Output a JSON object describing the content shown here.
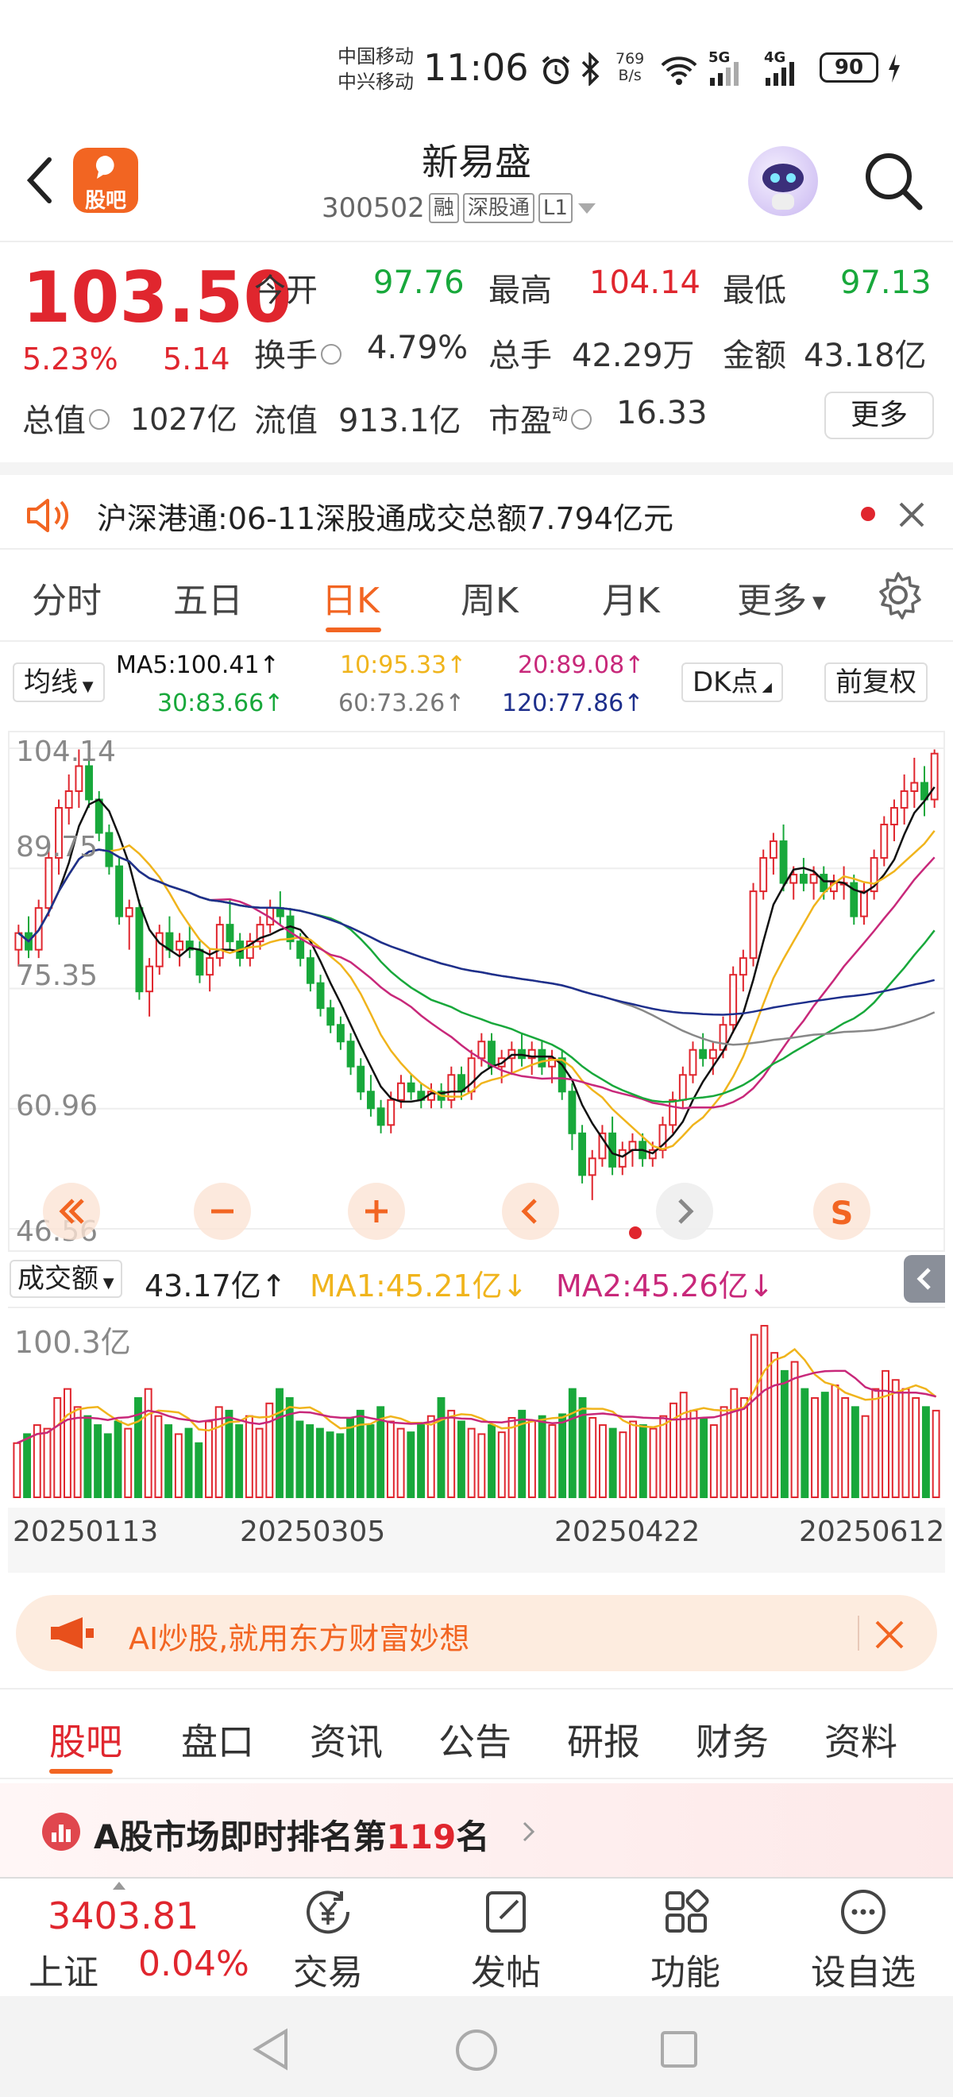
{
  "status_bar": {
    "carrier1": "中国移动",
    "carrier2": "中兴移动",
    "time": "11:06",
    "net_speed_value": "769",
    "net_speed_unit": "B/s",
    "signal1": "5G",
    "signal2": "4G",
    "battery": "90"
  },
  "header": {
    "logo_label": "股吧",
    "stock_name": "新易盛",
    "stock_code": "300502",
    "tag_rong": "融",
    "tag_connect": "深股通",
    "tag_level": "L1"
  },
  "quote": {
    "price": "103.50",
    "change_pct": "5.23%",
    "change": "5.14",
    "open_label": "今开",
    "open": "97.76",
    "high_label": "最高",
    "high": "104.14",
    "low_label": "最低",
    "low": "97.13",
    "turnover_label": "换手",
    "turnover": "4.79%",
    "volume_label": "总手",
    "volume": "42.29万",
    "amount_label": "金额",
    "amount": "43.18亿",
    "mcap_label": "总值",
    "mcap": "1027亿",
    "float_label": "流值",
    "float_mcap": "913.1亿",
    "pe_label": "市盈",
    "pe_super": "动",
    "pe": "16.33",
    "more_button": "更多"
  },
  "notice": {
    "prefix": "沪深港通:",
    "text": "06-11深股通成交总额7.794亿元"
  },
  "chart_tabs": [
    "分时",
    "五日",
    "日K",
    "周K",
    "月K",
    "更多"
  ],
  "active_chart_tab": "日K",
  "ma_bar": {
    "selector": "均线",
    "ma5": "MA5:100.41↑",
    "ma10": "10:95.33↑",
    "ma20": "20:89.08↑",
    "ma30": "30:83.66↑",
    "ma60": "60:73.26↑",
    "ma120": "120:77.86↑",
    "dk_button": "DK点",
    "adjust_button": "前复权"
  },
  "price_axis": [
    "104.14",
    "89.75",
    "75.35",
    "60.96",
    "46.56"
  ],
  "volume_bar": {
    "selector": "成交额",
    "value": "43.17亿↑",
    "ma1": "MA1:45.21亿↓",
    "ma2": "MA2:45.26亿↓",
    "axis_max": "100.3亿"
  },
  "dates": [
    "20250113",
    "20250305",
    "20250422",
    "20250612"
  ],
  "ad": {
    "text": "AI炒股,就用东方财富妙想"
  },
  "feature_tabs": [
    "股吧",
    "盘口",
    "资讯",
    "公告",
    "研报",
    "财务",
    "资料"
  ],
  "rank": {
    "prefix": "A股市场即时排名第",
    "number": "119",
    "suffix": "名"
  },
  "bottom_nav": {
    "index_value": "3403.81",
    "index_name": "上证",
    "index_pct": "0.04%",
    "trade": "交易",
    "post": "发帖",
    "function": "功能",
    "watch": "设自选"
  },
  "colors": {
    "up": "#e0262e",
    "down": "#18a83b",
    "accent": "#f26522",
    "ma5": "#111111",
    "ma10": "#f0b41c",
    "ma20": "#c8287a",
    "ma30": "#18a83b",
    "ma60": "#888888",
    "ma120": "#1e2f8c"
  },
  "chart_data": {
    "type": "candlestick",
    "y_range": [
      46.56,
      104.14
    ],
    "ohlc": [
      [
        80,
        83,
        78,
        82
      ],
      [
        82,
        84,
        79,
        80
      ],
      [
        80,
        86,
        79,
        85
      ],
      [
        85,
        92,
        84,
        91
      ],
      [
        91,
        98,
        89,
        97
      ],
      [
        97,
        101,
        95,
        99
      ],
      [
        99,
        104,
        97,
        102
      ],
      [
        102,
        103,
        97,
        98
      ],
      [
        98,
        99,
        93,
        94
      ],
      [
        94,
        95,
        89,
        90
      ],
      [
        90,
        91,
        83,
        84
      ],
      [
        84,
        86,
        80,
        85
      ],
      [
        85,
        86,
        74,
        75
      ],
      [
        75,
        79,
        72,
        78
      ],
      [
        78,
        83,
        77,
        82
      ],
      [
        82,
        84,
        79,
        80
      ],
      [
        80,
        82,
        78,
        81
      ],
      [
        81,
        83,
        79,
        80
      ],
      [
        80,
        81,
        76,
        77
      ],
      [
        77,
        80,
        75,
        79
      ],
      [
        79,
        84,
        78,
        83
      ],
      [
        83,
        86,
        80,
        81
      ],
      [
        81,
        82,
        78,
        79
      ],
      [
        79,
        82,
        78,
        81
      ],
      [
        81,
        84,
        80,
        83
      ],
      [
        83,
        86,
        82,
        85
      ],
      [
        85,
        87,
        83,
        84
      ],
      [
        84,
        85,
        80,
        81
      ],
      [
        81,
        82,
        78,
        79
      ],
      [
        79,
        80,
        75,
        76
      ],
      [
        76,
        77,
        72,
        73
      ],
      [
        73,
        74,
        70,
        71
      ],
      [
        71,
        72,
        68,
        69
      ],
      [
        69,
        70,
        65,
        66
      ],
      [
        66,
        67,
        62,
        63
      ],
      [
        63,
        65,
        60,
        61
      ],
      [
        61,
        62,
        58,
        59
      ],
      [
        59,
        63,
        58,
        62
      ],
      [
        62,
        65,
        61,
        64
      ],
      [
        64,
        65,
        62,
        63
      ],
      [
        63,
        64,
        61,
        62
      ],
      [
        62,
        64,
        61,
        63
      ],
      [
        63,
        64,
        61,
        62
      ],
      [
        62,
        66,
        61,
        65
      ],
      [
        65,
        66,
        62,
        63
      ],
      [
        63,
        68,
        62,
        67
      ],
      [
        67,
        70,
        66,
        69
      ],
      [
        69,
        70,
        65,
        66
      ],
      [
        66,
        68,
        64,
        67
      ],
      [
        67,
        69,
        65,
        68
      ],
      [
        68,
        70,
        66,
        67
      ],
      [
        67,
        69,
        65,
        68
      ],
      [
        68,
        69,
        65,
        66
      ],
      [
        66,
        68,
        64,
        67
      ],
      [
        67,
        68,
        62,
        63
      ],
      [
        63,
        64,
        56,
        58
      ],
      [
        58,
        59,
        52,
        53
      ],
      [
        53,
        56,
        50,
        55
      ],
      [
        55,
        59,
        54,
        58
      ],
      [
        58,
        60,
        53,
        54
      ],
      [
        54,
        57,
        53,
        56
      ],
      [
        56,
        58,
        54,
        57
      ],
      [
        57,
        58,
        54,
        55
      ],
      [
        55,
        57,
        54,
        56
      ],
      [
        56,
        60,
        55,
        59
      ],
      [
        59,
        63,
        58,
        62
      ],
      [
        62,
        66,
        61,
        65
      ],
      [
        65,
        69,
        64,
        68
      ],
      [
        68,
        70,
        66,
        67
      ],
      [
        67,
        69,
        65,
        68
      ],
      [
        68,
        72,
        67,
        71
      ],
      [
        71,
        78,
        70,
        77
      ],
      [
        77,
        80,
        75,
        79
      ],
      [
        79,
        88,
        78,
        87
      ],
      [
        87,
        92,
        86,
        91
      ],
      [
        91,
        94,
        89,
        93
      ],
      [
        93,
        95,
        87,
        88
      ],
      [
        88,
        90,
        86,
        89
      ],
      [
        89,
        91,
        87,
        88
      ],
      [
        88,
        90,
        86,
        89
      ],
      [
        89,
        90,
        86,
        87
      ],
      [
        87,
        89,
        86,
        88
      ],
      [
        88,
        90,
        86,
        88
      ],
      [
        88,
        89,
        83,
        84
      ],
      [
        84,
        88,
        83,
        87
      ],
      [
        87,
        92,
        86,
        91
      ],
      [
        91,
        96,
        90,
        95
      ],
      [
        95,
        98,
        93,
        97
      ],
      [
        97,
        101,
        95,
        99
      ],
      [
        99,
        103,
        97,
        100
      ],
      [
        100,
        102,
        96,
        98
      ],
      [
        98,
        104,
        97,
        103.5
      ]
    ],
    "volume_max": 100.3,
    "volumes": [
      30,
      35,
      40,
      38,
      55,
      60,
      50,
      45,
      40,
      35,
      42,
      38,
      55,
      60,
      45,
      40,
      35,
      38,
      30,
      42,
      50,
      48,
      40,
      45,
      38,
      52,
      60,
      55,
      42,
      40,
      38,
      36,
      35,
      44,
      48,
      40,
      50,
      42,
      38,
      36,
      40,
      45,
      55,
      48,
      42,
      38,
      35,
      40,
      36,
      44,
      48,
      42,
      45,
      40,
      46,
      60,
      55,
      44,
      40,
      38,
      36,
      42,
      40,
      38,
      45,
      52,
      58,
      48,
      44,
      40,
      50,
      60,
      55,
      90,
      95,
      80,
      70,
      75,
      60,
      55,
      58,
      62,
      55,
      50,
      45,
      60,
      70,
      65,
      60,
      55,
      50,
      48
    ]
  }
}
